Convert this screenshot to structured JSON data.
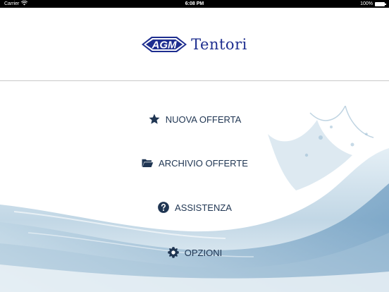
{
  "status_bar": {
    "carrier": "Carrier",
    "time": "6:08 PM",
    "battery": "100%",
    "battery_level": 1.0
  },
  "header": {
    "logo_mark": "AGM",
    "logo_name": "Tentori"
  },
  "menu": {
    "items": [
      {
        "label": "NUOVA OFFERTA",
        "icon": "star-icon"
      },
      {
        "label": "ARCHIVIO OFFERTE",
        "icon": "folder-open-icon"
      },
      {
        "label": "ASSISTENZA",
        "icon": "question-circle-icon"
      },
      {
        "label": "OPZIONI",
        "icon": "gear-icon"
      }
    ]
  },
  "colors": {
    "menu_text": "#1f3552",
    "brand_blue": "#1e2e8f",
    "status_bar": "#000000"
  }
}
